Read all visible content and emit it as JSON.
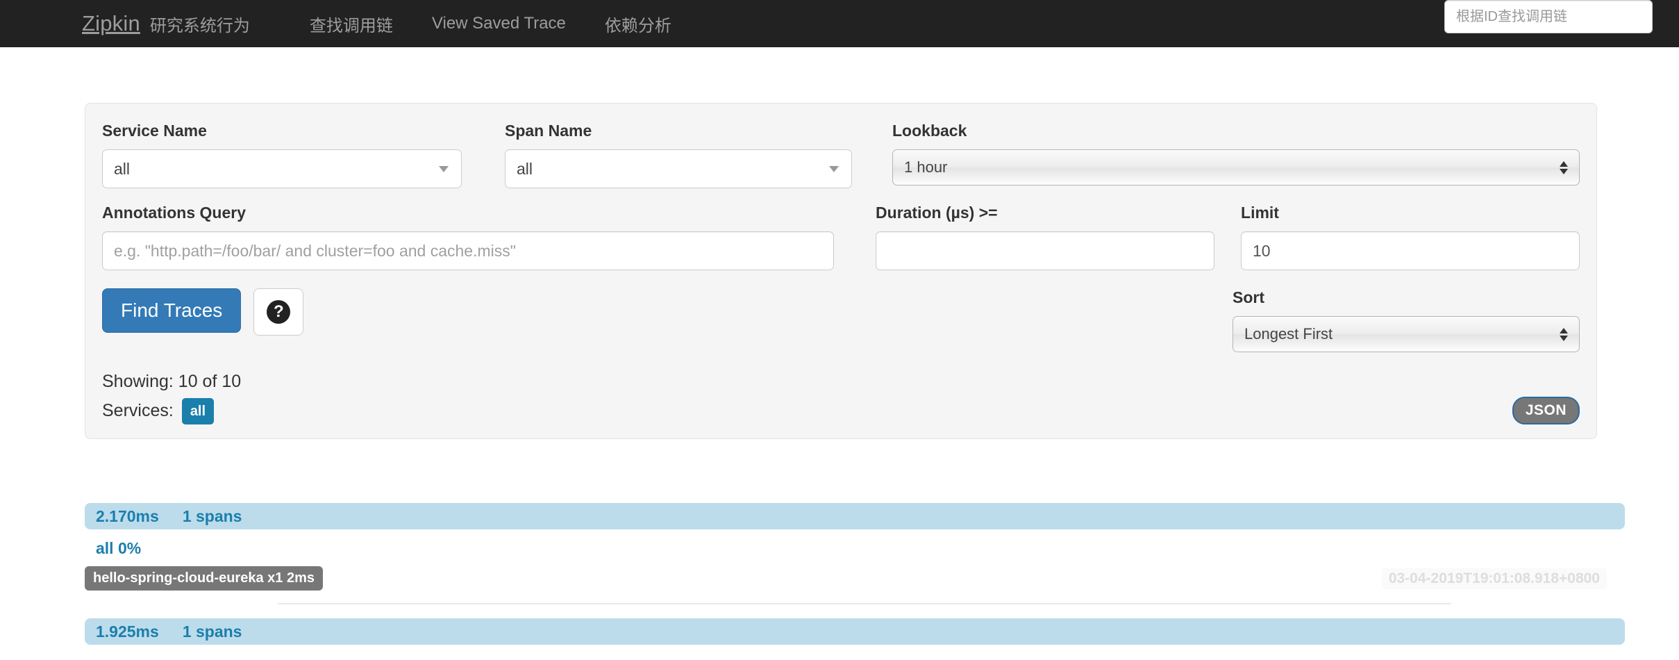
{
  "navbar": {
    "brand": "Zipkin",
    "brand_sub": "研究系统行为",
    "links": [
      {
        "label": "查找调用链",
        "name": "nav-find-traces"
      },
      {
        "label": "View Saved Trace",
        "name": "nav-view-saved-trace"
      },
      {
        "label": "依赖分析",
        "name": "nav-dependencies"
      }
    ],
    "search_placeholder": "根据ID查找调用链",
    "search_value": "",
    "background": "#222222",
    "text_color": "#9d9d9d"
  },
  "search_form": {
    "service_name": {
      "label": "Service Name",
      "value": "all"
    },
    "span_name": {
      "label": "Span Name",
      "value": "all"
    },
    "lookback": {
      "label": "Lookback",
      "value": "1 hour"
    },
    "annotations_query": {
      "label": "Annotations Query",
      "value": "",
      "placeholder": "e.g. \"http.path=/foo/bar/ and cluster=foo and cache.miss\""
    },
    "duration": {
      "label": "Duration (µs) >=",
      "value": "",
      "placeholder": ""
    },
    "limit": {
      "label": "Limit",
      "value": "10"
    },
    "sort": {
      "label": "Sort",
      "value": "Longest First"
    },
    "find_traces_label": "Find Traces",
    "help_icon": "question-mark-icon",
    "showing": "Showing: 10 of 10",
    "services_label": "Services:",
    "services_badge": "all",
    "json_label": "JSON",
    "accent_color": "#337ab7",
    "badge_color": "#1b7fab"
  },
  "results": [
    {
      "duration": "2.170ms",
      "spans": "1 spans",
      "percent": "all 0%",
      "service_tag": "hello-spring-cloud-eureka x1 2ms",
      "timestamp": "03-04-2019T19:01:08.918+0800"
    },
    {
      "duration": "1.925ms",
      "spans": "1 spans",
      "percent": "",
      "service_tag": "",
      "timestamp": ""
    }
  ]
}
